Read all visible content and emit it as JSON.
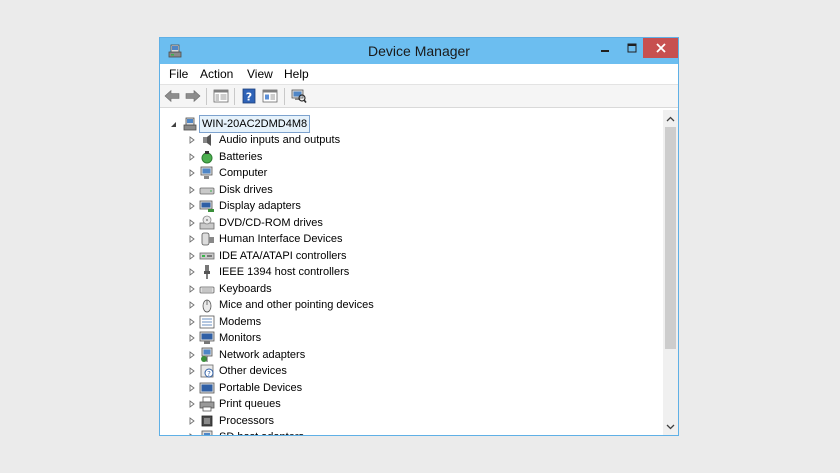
{
  "window": {
    "title": "Device Manager"
  },
  "menu": [
    "File",
    "Action",
    "View",
    "Help"
  ],
  "toolbar": {
    "buttons": [
      {
        "name": "back-button",
        "icon": "arrow-left-icon"
      },
      {
        "name": "forward-button",
        "icon": "arrow-right-icon"
      },
      {
        "name": "show-hide-console-tree-button",
        "icon": "console-tree-icon"
      },
      {
        "name": "help-button",
        "icon": "help-icon"
      },
      {
        "name": "properties-button",
        "icon": "properties-icon"
      },
      {
        "name": "scan-hardware-changes-button",
        "icon": "scan-hardware-icon"
      }
    ]
  },
  "tree": {
    "root": {
      "label": "WIN-20AC2DMD4M8",
      "expanded": true
    },
    "categories": [
      {
        "label": "Audio inputs and outputs",
        "icon": "audio-icon"
      },
      {
        "label": "Batteries",
        "icon": "battery-icon"
      },
      {
        "label": "Computer",
        "icon": "computer-icon"
      },
      {
        "label": "Disk drives",
        "icon": "disk-drive-icon"
      },
      {
        "label": "Display adapters",
        "icon": "display-adapter-icon"
      },
      {
        "label": "DVD/CD-ROM drives",
        "icon": "dvd-drive-icon"
      },
      {
        "label": "Human Interface Devices",
        "icon": "hid-icon"
      },
      {
        "label": "IDE ATA/ATAPI controllers",
        "icon": "ide-controller-icon"
      },
      {
        "label": "IEEE 1394 host controllers",
        "icon": "ieee1394-icon"
      },
      {
        "label": "Keyboards",
        "icon": "keyboard-icon"
      },
      {
        "label": "Mice and other pointing devices",
        "icon": "mouse-icon"
      },
      {
        "label": "Modems",
        "icon": "modem-icon"
      },
      {
        "label": "Monitors",
        "icon": "monitor-icon"
      },
      {
        "label": "Network adapters",
        "icon": "network-adapter-icon"
      },
      {
        "label": "Other devices",
        "icon": "other-devices-icon"
      },
      {
        "label": "Portable Devices",
        "icon": "portable-device-icon"
      },
      {
        "label": "Print queues",
        "icon": "printer-icon"
      },
      {
        "label": "Processors",
        "icon": "processor-icon"
      },
      {
        "label": "SD host adapters",
        "icon": "sd-adapter-icon"
      }
    ]
  },
  "colors": {
    "titlebar": "#6cbef0",
    "close_button": "#c75050",
    "selection_border": "#7da2ce"
  }
}
